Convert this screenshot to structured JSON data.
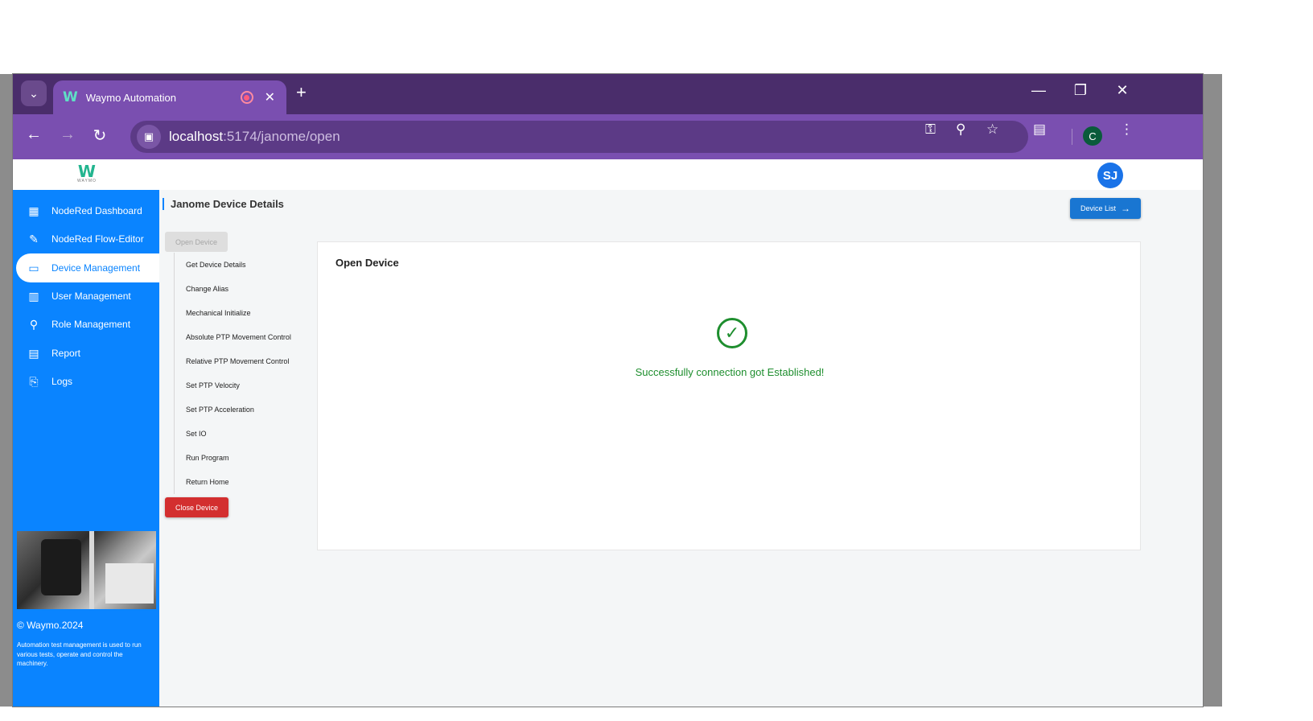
{
  "browser": {
    "tab_title": "Waymo Automation",
    "tab_logo": "W",
    "new_tab": "+",
    "url_host": "localhost",
    "url_path": ":5174/janome/open",
    "profile_initial": "C",
    "icons": [
      "tab-search-icon",
      "recording-icon",
      "close-icon",
      "back-icon",
      "forward-icon",
      "reload-icon",
      "camera-icon",
      "key-icon",
      "zoom-icon",
      "star-icon",
      "extensions-icon",
      "menu-icon",
      "minimize-icon",
      "restore-icon",
      "window-close-icon"
    ]
  },
  "header": {
    "logo_mark": "W",
    "logo_sub": "WAYMO",
    "avatar_initials": "SJ"
  },
  "sidebar": {
    "items": [
      {
        "label": "NodeRed Dashboard",
        "icon": "sitemap-icon"
      },
      {
        "label": "NodeRed Flow-Editor",
        "icon": "flow-editor-icon"
      },
      {
        "label": "Device Management",
        "icon": "monitor-icon",
        "active": true
      },
      {
        "label": "User Management",
        "icon": "user-board-icon"
      },
      {
        "label": "Role Management",
        "icon": "role-icon"
      },
      {
        "label": "Report",
        "icon": "chart-icon"
      },
      {
        "label": "Logs",
        "icon": "logs-icon"
      }
    ],
    "copyright": "© Waymo.2024",
    "description": "Automation test management is used to run various tests, operate and control the machinery."
  },
  "content": {
    "page_title": "Janome Device Details",
    "device_list_button": "Device List",
    "open_device_button": "Open Device",
    "actions": [
      "Get Device Details",
      "Change Alias",
      "Mechanical Initialize",
      "Absolute PTP Movement Control",
      "Relative PTP Movement Control",
      "Set PTP Velocity",
      "Set PTP Acceleration",
      "Set IO",
      "Run Program",
      "Return Home"
    ],
    "close_device_button": "Close Device",
    "panel_title": "Open Device",
    "success_message": "Successfully connection got Established!"
  },
  "colors": {
    "sidebar": "#0a84ff",
    "success": "#1e8e2e",
    "danger": "#d32f2f",
    "primary_button": "#1976d2",
    "browser_frame": "#4a2d6b"
  }
}
